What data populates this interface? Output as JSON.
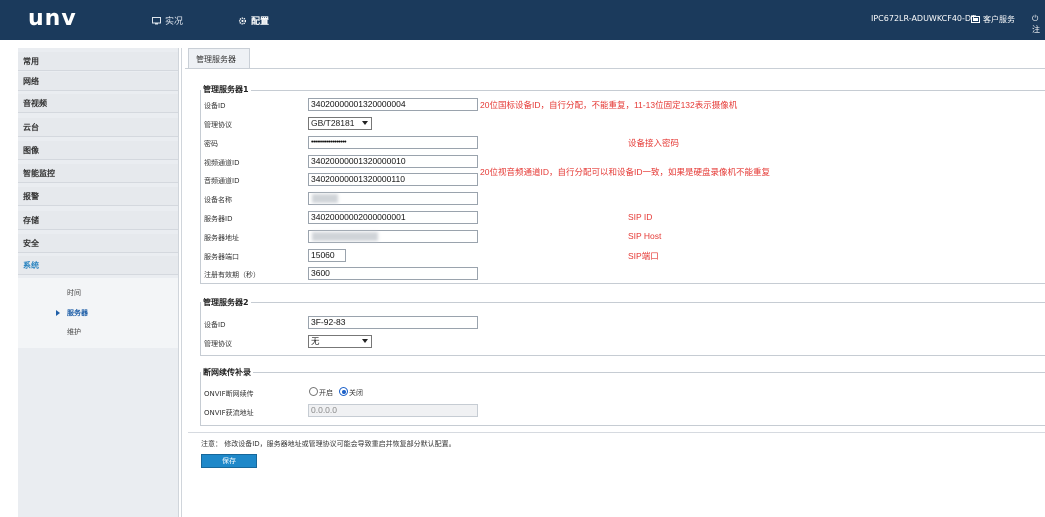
{
  "header": {
    "logo": "unv",
    "nav_live": "实况",
    "nav_config": "配置",
    "device_name": "IPC672LR-ADUWKCF40-DT",
    "client_service": "客户服务",
    "logout_partial": "注"
  },
  "sidebar": {
    "items": [
      "常用",
      "网络",
      "音视频",
      "云台",
      "图像",
      "智能监控",
      "报警",
      "存储",
      "安全",
      "系统"
    ],
    "active_item": "系统",
    "sub_items": [
      "时间",
      "服务器",
      "维护"
    ],
    "active_sub": "服务器"
  },
  "tab": {
    "label": "管理服务器"
  },
  "server1": {
    "title": "管理服务器1",
    "fields": {
      "device_id": {
        "label": "设备ID",
        "value": "34020000001320000004"
      },
      "protocol": {
        "label": "管理协议",
        "value": "GB/T28181"
      },
      "password": {
        "label": "密码",
        "value": "••••••••••••••••••"
      },
      "video_channel_id": {
        "label": "视频通道ID",
        "value": "34020000001320000010"
      },
      "audio_channel_id": {
        "label": "音频通道ID",
        "value": "34020000001320000110"
      },
      "device_name": {
        "label": "设备名称",
        "value": ""
      },
      "server_id": {
        "label": "服务器ID",
        "value": "34020000002000000001"
      },
      "server_address": {
        "label": "服务器地址",
        "value": ""
      },
      "server_port": {
        "label": "服务器端口",
        "value": "15060"
      },
      "register_valid": {
        "label": "注册有效期（秒）",
        "value": "3600"
      }
    },
    "notes": {
      "device_id": "20位国标设备ID，自行分配，不能重复，11-13位固定132表示摄像机",
      "password": "设备接入密码",
      "channel": "20位视音频通道ID，自行分配可以和设备ID一致，如果是硬盘录像机不能重复",
      "sip_id": "SIP ID",
      "sip_host": "SIP Host",
      "sip_port": "SIP端口"
    }
  },
  "server2": {
    "title": "管理服务器2",
    "fields": {
      "device_id": {
        "label": "设备ID",
        "value": "3F-92-83"
      },
      "protocol": {
        "label": "管理协议",
        "value": "无"
      }
    }
  },
  "offline": {
    "title": "断网续传补录",
    "onvif_label": "ONVIF断网续传",
    "option_on": "开启",
    "option_off": "关闭",
    "selected": "关闭",
    "address_label": "ONVIF获流地址",
    "address_value": "0.0.0.0"
  },
  "footer": {
    "notice": "注意： 修改设备ID，服务器地址或管理协议可能会导致重启并恢复部分默认配置。",
    "save_label": "保存"
  },
  "colors": {
    "header_bg": "#1b3a5c",
    "note_red": "#e53935",
    "accent_blue": "#1e88c9"
  }
}
